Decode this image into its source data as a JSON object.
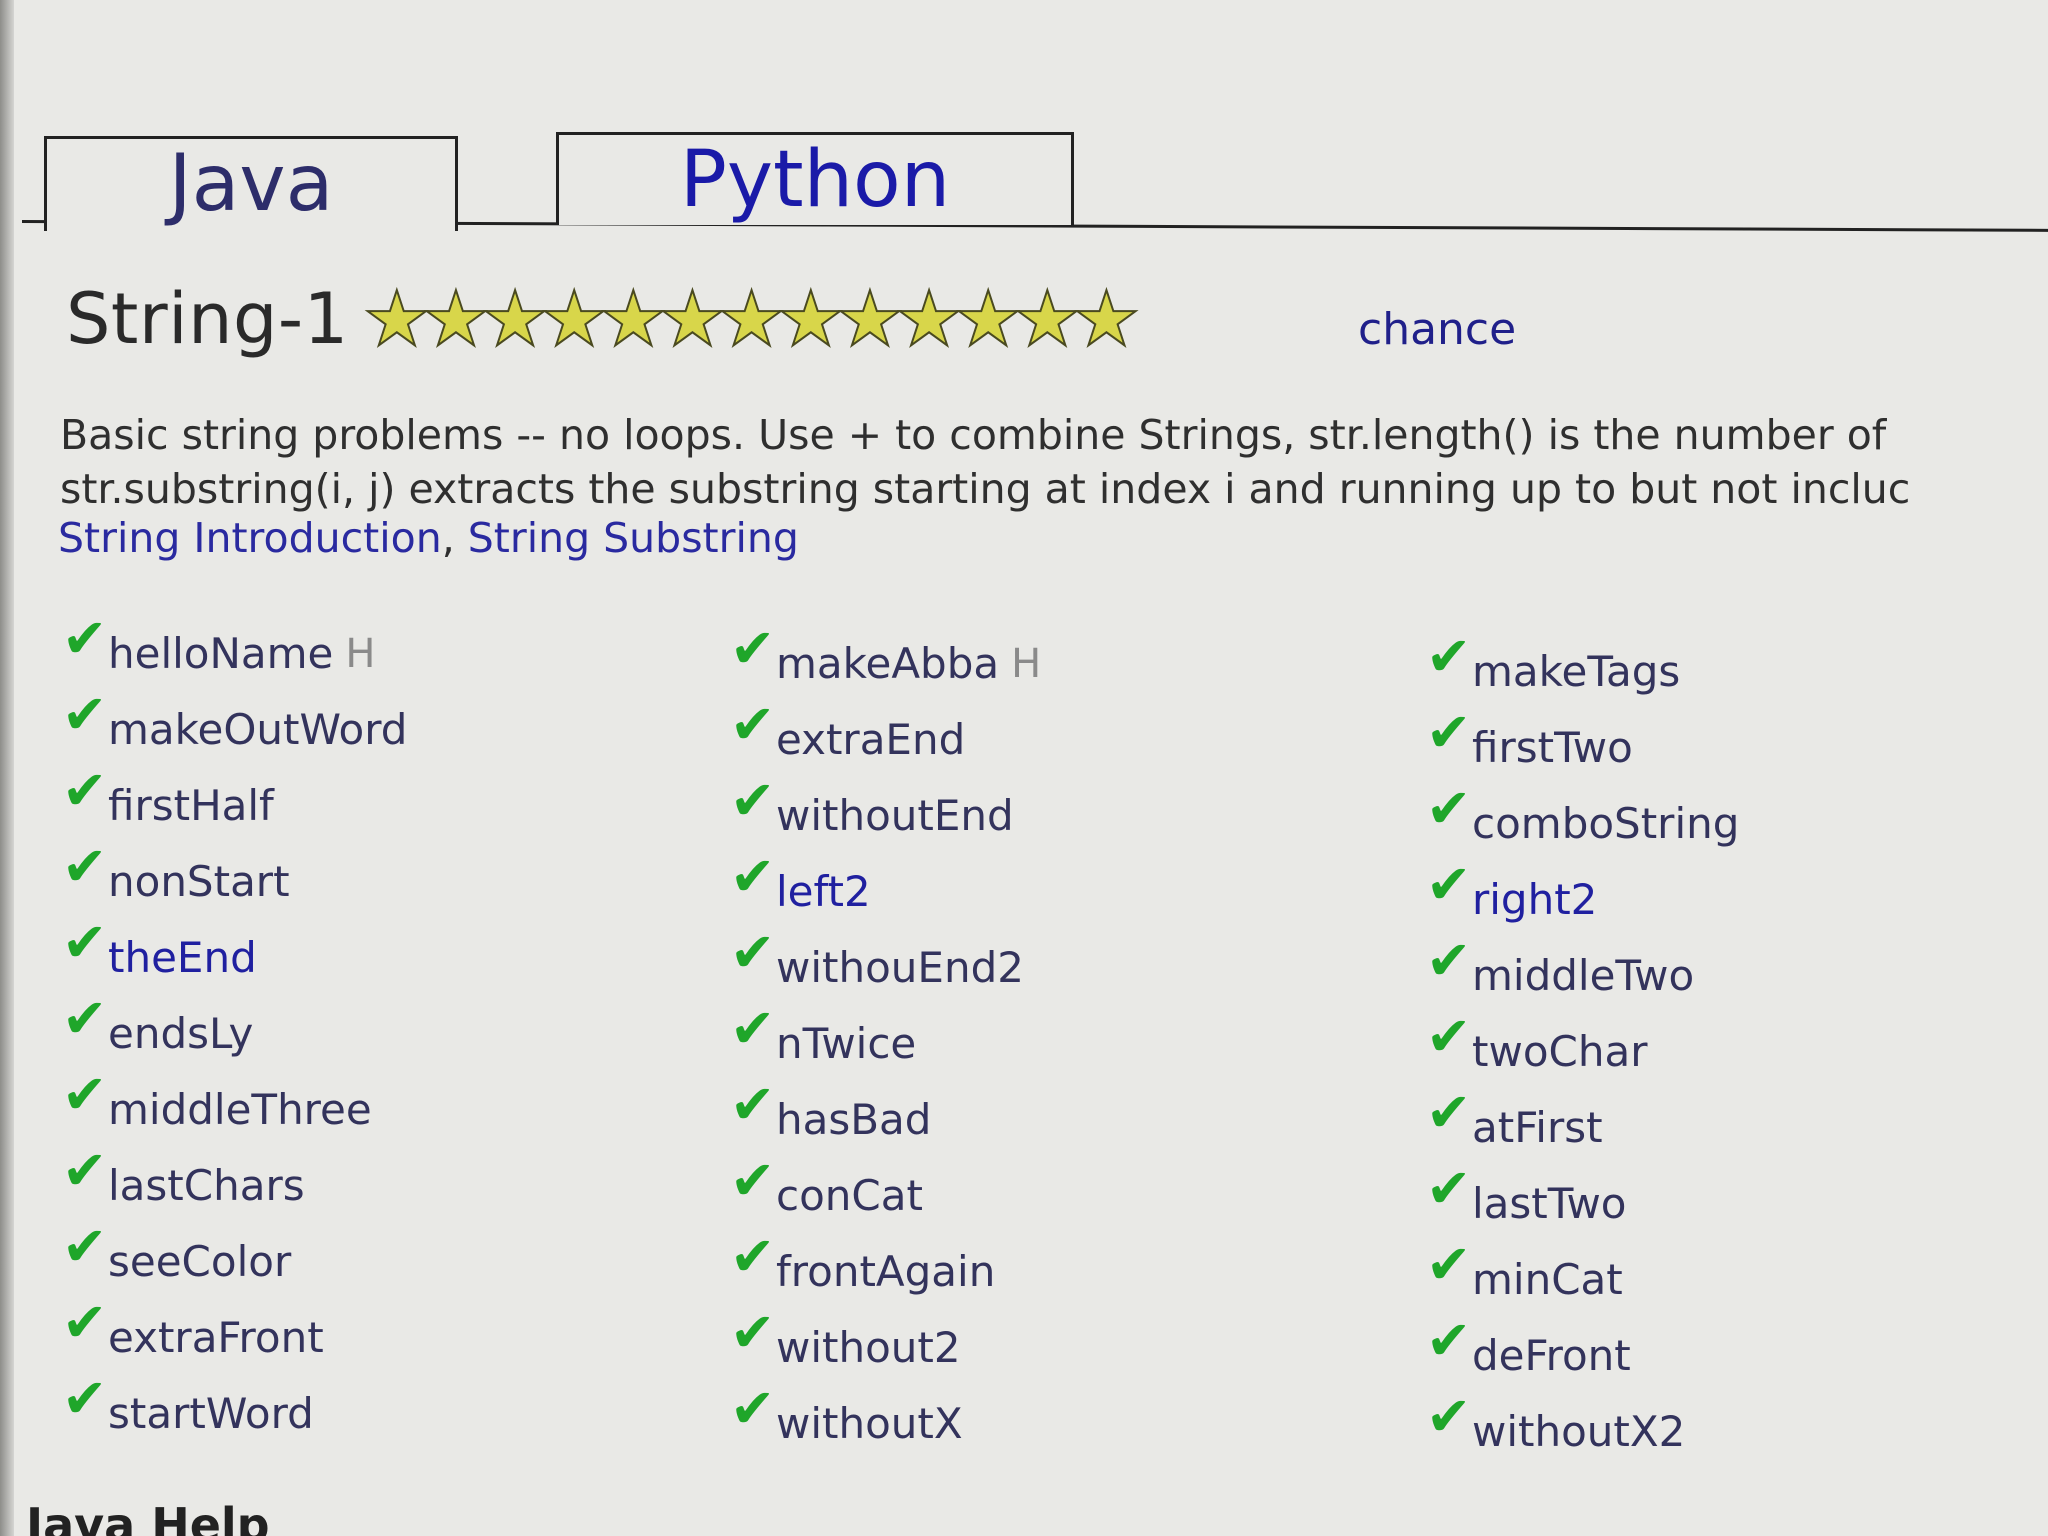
{
  "tabs": [
    {
      "label": "Java"
    },
    {
      "label": "Python"
    }
  ],
  "section": {
    "title": "String-1",
    "stars": 13,
    "star_glyph": "★",
    "chance_link": "chance"
  },
  "description": {
    "line1": "Basic string problems -- no loops. Use + to combine Strings, str.length() is the number of",
    "line2": "str.substring(i, j) extracts the substring starting at index i and running up to but not incluc",
    "links": [
      "String Introduction",
      "String Substring"
    ],
    "link_separator": ", "
  },
  "check_glyph": "✔",
  "columns": [
    {
      "problems": [
        {
          "name": "helloName",
          "hint": "H"
        },
        {
          "name": "makeOutWord"
        },
        {
          "name": "firstHalf"
        },
        {
          "name": "nonStart"
        },
        {
          "name": "theEnd"
        },
        {
          "name": "endsLy"
        },
        {
          "name": "middleThree"
        },
        {
          "name": "lastChars"
        },
        {
          "name": "seeColor"
        },
        {
          "name": "extraFront"
        },
        {
          "name": "startWord"
        }
      ]
    },
    {
      "problems": [
        {
          "name": "makeAbba",
          "hint": "H"
        },
        {
          "name": "extraEnd"
        },
        {
          "name": "withoutEnd"
        },
        {
          "name": "left2"
        },
        {
          "name": "withouEnd2"
        },
        {
          "name": "nTwice"
        },
        {
          "name": "hasBad"
        },
        {
          "name": "conCat"
        },
        {
          "name": "frontAgain"
        },
        {
          "name": "without2"
        },
        {
          "name": "withoutX"
        }
      ]
    },
    {
      "problems": [
        {
          "name": "makeTags"
        },
        {
          "name": "firstTwo"
        },
        {
          "name": "comboString"
        },
        {
          "name": "right2"
        },
        {
          "name": "middleTwo"
        },
        {
          "name": "twoChar"
        },
        {
          "name": "atFirst"
        },
        {
          "name": "lastTwo"
        },
        {
          "name": "minCat"
        },
        {
          "name": "deFront"
        },
        {
          "name": "withoutX2"
        }
      ]
    }
  ],
  "footer": {
    "heading": "Java Help"
  },
  "colors": {
    "check": "#1fa62a",
    "link": "#2020a0",
    "visited_link": "#33335c",
    "star_fill": "#d8d64a"
  }
}
